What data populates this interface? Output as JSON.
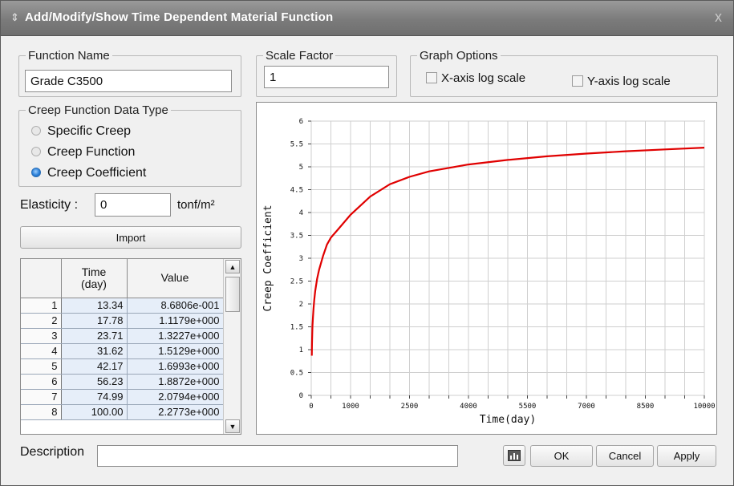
{
  "window": {
    "title": "Add/Modify/Show Time Dependent Material Function",
    "close_glyph": "x",
    "title_glyph": "⇕"
  },
  "function_name": {
    "legend": "Function Name",
    "value": "Grade C3500"
  },
  "scale_factor": {
    "legend": "Scale Factor",
    "value": "1"
  },
  "graph_options": {
    "legend": "Graph Options",
    "x_log": "X-axis log scale",
    "y_log": "Y-axis log scale",
    "x_log_checked": false,
    "y_log_checked": false
  },
  "creep_type": {
    "legend": "Creep Function Data Type",
    "options": [
      "Specific Creep",
      "Creep Function",
      "Creep Coefficient"
    ],
    "selected_index": 2
  },
  "elasticity": {
    "label": "Elasticity :",
    "value": "0",
    "unit": "tonf/m²"
  },
  "import_button": "Import",
  "table": {
    "headers": [
      "Time\n(day)",
      "Value"
    ],
    "rows": [
      [
        "1",
        "13.34",
        "8.6806e-001"
      ],
      [
        "2",
        "17.78",
        "1.1179e+000"
      ],
      [
        "3",
        "23.71",
        "1.3227e+000"
      ],
      [
        "4",
        "31.62",
        "1.5129e+000"
      ],
      [
        "5",
        "42.17",
        "1.6993e+000"
      ],
      [
        "6",
        "56.23",
        "1.8872e+000"
      ],
      [
        "7",
        "74.99",
        "2.0794e+000"
      ],
      [
        "8",
        "100.00",
        "2.2773e+000"
      ]
    ]
  },
  "chart_data": {
    "type": "line",
    "title": "",
    "xlabel": "Time(day)",
    "ylabel": "Creep Coefficient",
    "xlim": [
      0,
      10000
    ],
    "ylim": [
      0,
      6
    ],
    "xticks": [
      "0",
      "1000",
      "2500",
      "4000",
      "5500",
      "7000",
      "8500",
      "10000"
    ],
    "yticks": [
      "0",
      "0.5",
      "1",
      "1.5",
      "2",
      "2.5",
      "3",
      "3.5",
      "4",
      "4.5",
      "5",
      "5.5",
      "6"
    ],
    "grid": true,
    "series": [
      {
        "color": "#e00000",
        "x": [
          13.34,
          17.78,
          23.71,
          31.62,
          42.17,
          56.23,
          74.99,
          100,
          150,
          200,
          300,
          400,
          500,
          700,
          1000,
          1500,
          2000,
          2500,
          3000,
          4000,
          5000,
          6000,
          7000,
          8000,
          9000,
          10000
        ],
        "y": [
          0.868,
          1.118,
          1.323,
          1.513,
          1.699,
          1.887,
          2.079,
          2.277,
          2.55,
          2.75,
          3.05,
          3.3,
          3.45,
          3.65,
          3.95,
          4.35,
          4.62,
          4.78,
          4.9,
          5.05,
          5.15,
          5.23,
          5.29,
          5.34,
          5.38,
          5.42
        ]
      }
    ]
  },
  "description": {
    "label": "Description",
    "value": ""
  },
  "buttons": {
    "ok": "OK",
    "cancel": "Cancel",
    "apply": "Apply"
  }
}
